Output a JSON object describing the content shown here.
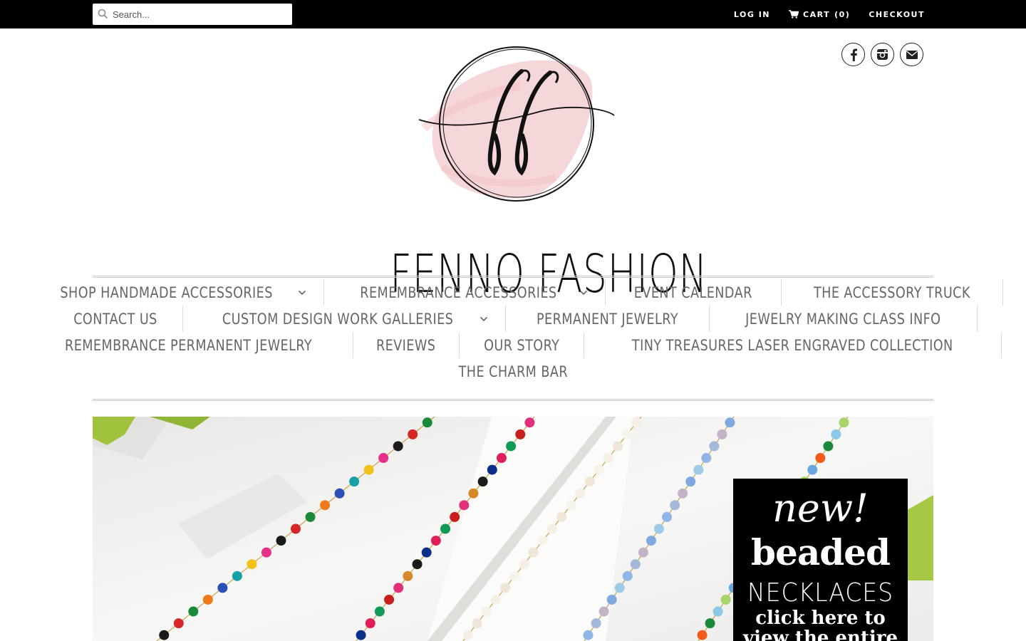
{
  "topbar": {
    "search_placeholder": "Search...",
    "login_label": "LOG IN",
    "cart_label": "CART",
    "cart_count": "(0)",
    "checkout_label": "CHECKOUT"
  },
  "social": {
    "icons": [
      "facebook-icon",
      "instagram-icon",
      "email-icon"
    ]
  },
  "brand": {
    "monogram": "ff",
    "name": "FENNO FASHION"
  },
  "nav": {
    "rows": [
      [
        {
          "label": "SHOP HANDMADE ACCESSORIES",
          "dropdown": true
        },
        {
          "label": "REMEMBRANCE ACCESSORIES",
          "dropdown": true
        },
        {
          "label": "EVENT CALENDAR",
          "dropdown": false
        },
        {
          "label": "THE ACCESSORY TRUCK",
          "dropdown": false
        }
      ],
      [
        {
          "label": "CONTACT US",
          "dropdown": false
        },
        {
          "label": "CUSTOM DESIGN WORK GALLERIES",
          "dropdown": true
        },
        {
          "label": "PERMANENT JEWELRY",
          "dropdown": false
        },
        {
          "label": "JEWELRY MAKING CLASS INFO",
          "dropdown": false
        }
      ],
      [
        {
          "label": "REMEMBRANCE PERMANENT JEWELRY",
          "dropdown": false
        },
        {
          "label": "REVIEWS",
          "dropdown": false
        },
        {
          "label": "OUR STORY",
          "dropdown": false
        },
        {
          "label": "TINY TREASURES LASER ENGRAVED COLLECTION",
          "dropdown": false
        }
      ],
      [
        {
          "label": "THE CHARM BAR",
          "dropdown": false
        }
      ]
    ]
  },
  "hero": {
    "promo_script": "new!",
    "promo_bold": "beaded",
    "promo_caps": "NECKLACES",
    "promo_cta_line1": "click here to",
    "promo_cta_line2": "view the entire"
  },
  "colors": {
    "topbar_bg": "#000000",
    "nav_text": "#666666",
    "logo_blush": "#f2c4c8"
  }
}
